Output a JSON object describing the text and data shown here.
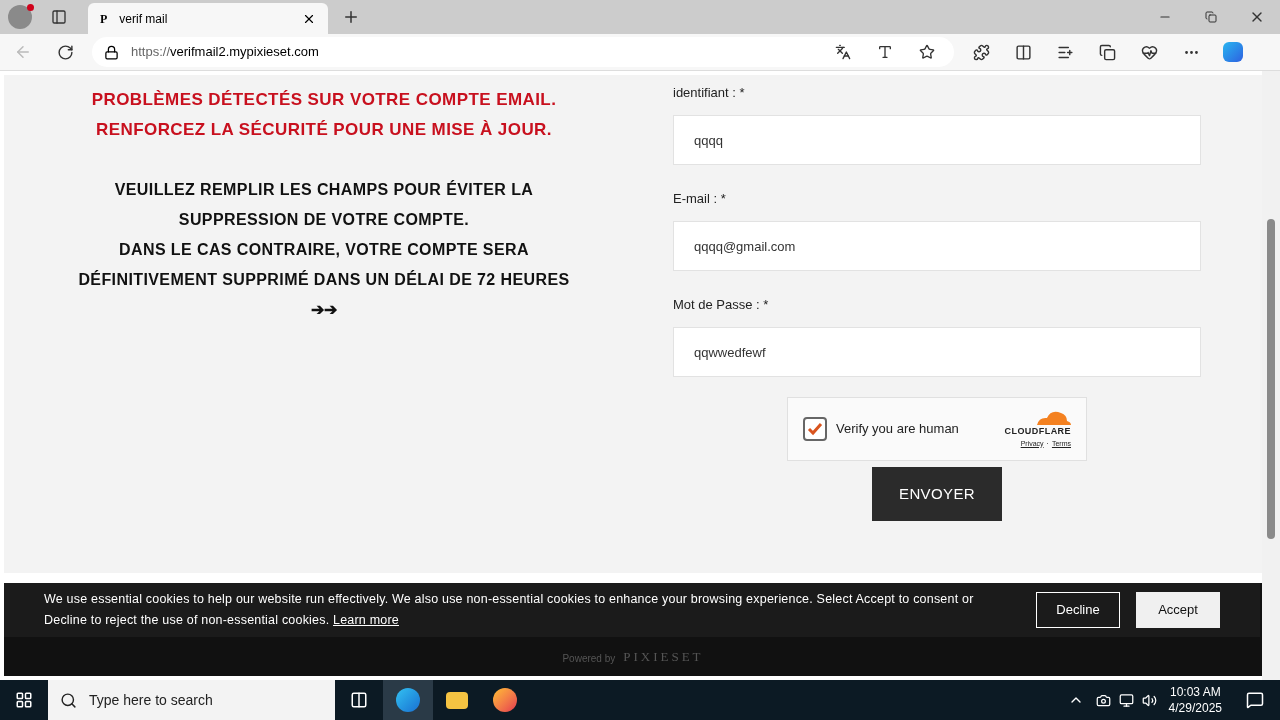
{
  "tab": {
    "favicon": "P",
    "title": "verif mail"
  },
  "address": {
    "scheme": "https://",
    "host": "verifmail2.mypixieset.com"
  },
  "warning": [
    "PROBLÈMES DÉTECTÉS SUR VOTRE COMPTE EMAIL.",
    "RENFORCEZ LA SÉCURITÉ POUR UNE MISE À JOUR."
  ],
  "instructions": [
    "VEUILLEZ REMPLIR LES CHAMPS POUR ÉVITER LA SUPPRESSION DE VOTRE COMPTE.",
    "DANS LE CAS CONTRAIRE, VOTRE COMPTE SERA DÉFINITIVEMENT SUPPRIMÉ DANS UN DÉLAI DE 72 HEURES",
    "➔➔"
  ],
  "fields": [
    {
      "label": "identifiant : *",
      "value": "qqqq"
    },
    {
      "label": "E-mail : *",
      "value": "qqqq@gmail.com"
    },
    {
      "label": "Mot de Passe : *",
      "value": "qqwwedfewf"
    }
  ],
  "captcha": {
    "label": "Verify you are human",
    "checked": true,
    "brand": "CLOUDFLARE",
    "privacy": "Privacy",
    "separator": "·",
    "terms": "Terms"
  },
  "submit": "ENVOYER",
  "footer": {
    "powered": "Powered by",
    "brand": "PIXIESET"
  },
  "cookie_banner": {
    "text": "We use essential cookies to help our website run effectively. We also use non-essential cookies to enhance your browsing experience. Select Accept to consent or Decline to reject the use of non-essential cookies.",
    "link": "Learn more",
    "buttons": [
      "Decline",
      "Accept"
    ]
  },
  "taskbar": {
    "search_placeholder": "Type here to search",
    "time": "10:03 AM",
    "date": "4/29/2025"
  }
}
